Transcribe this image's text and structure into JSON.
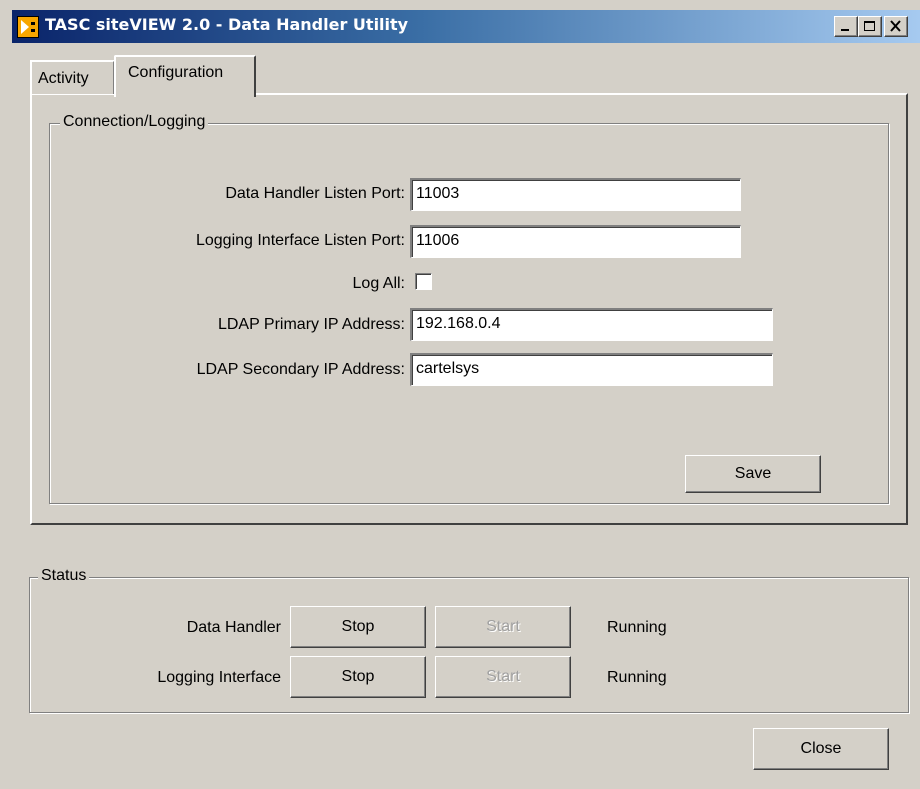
{
  "window": {
    "title": "TASC siteVIEW 2.0 - Data Handler Utility",
    "app_icon": "labview-run-arrow-icon"
  },
  "tabs": [
    {
      "label": "Activity",
      "selected": false
    },
    {
      "label": "Configuration",
      "selected": true
    }
  ],
  "connection": {
    "group_label": "Connection/Logging",
    "fields": {
      "data_handler_port": {
        "label": "Data Handler Listen Port:",
        "value": "11003"
      },
      "logging_port": {
        "label": "Logging Interface Listen Port:",
        "value": "11006"
      },
      "log_all": {
        "label": "Log All:",
        "checked": false
      },
      "ldap_primary": {
        "label": "LDAP Primary IP Address:",
        "value": "192.168.0.4"
      },
      "ldap_secondary": {
        "label": "LDAP Secondary IP Address:",
        "value": "cartelsys"
      }
    },
    "save_label": "Save"
  },
  "status": {
    "group_label": "Status",
    "rows": [
      {
        "label": "Data Handler",
        "stop_label": "Stop",
        "start_label": "Start",
        "state": "Running"
      },
      {
        "label": "Logging Interface",
        "stop_label": "Stop",
        "start_label": "Start",
        "state": "Running"
      }
    ]
  },
  "close_label": "Close"
}
